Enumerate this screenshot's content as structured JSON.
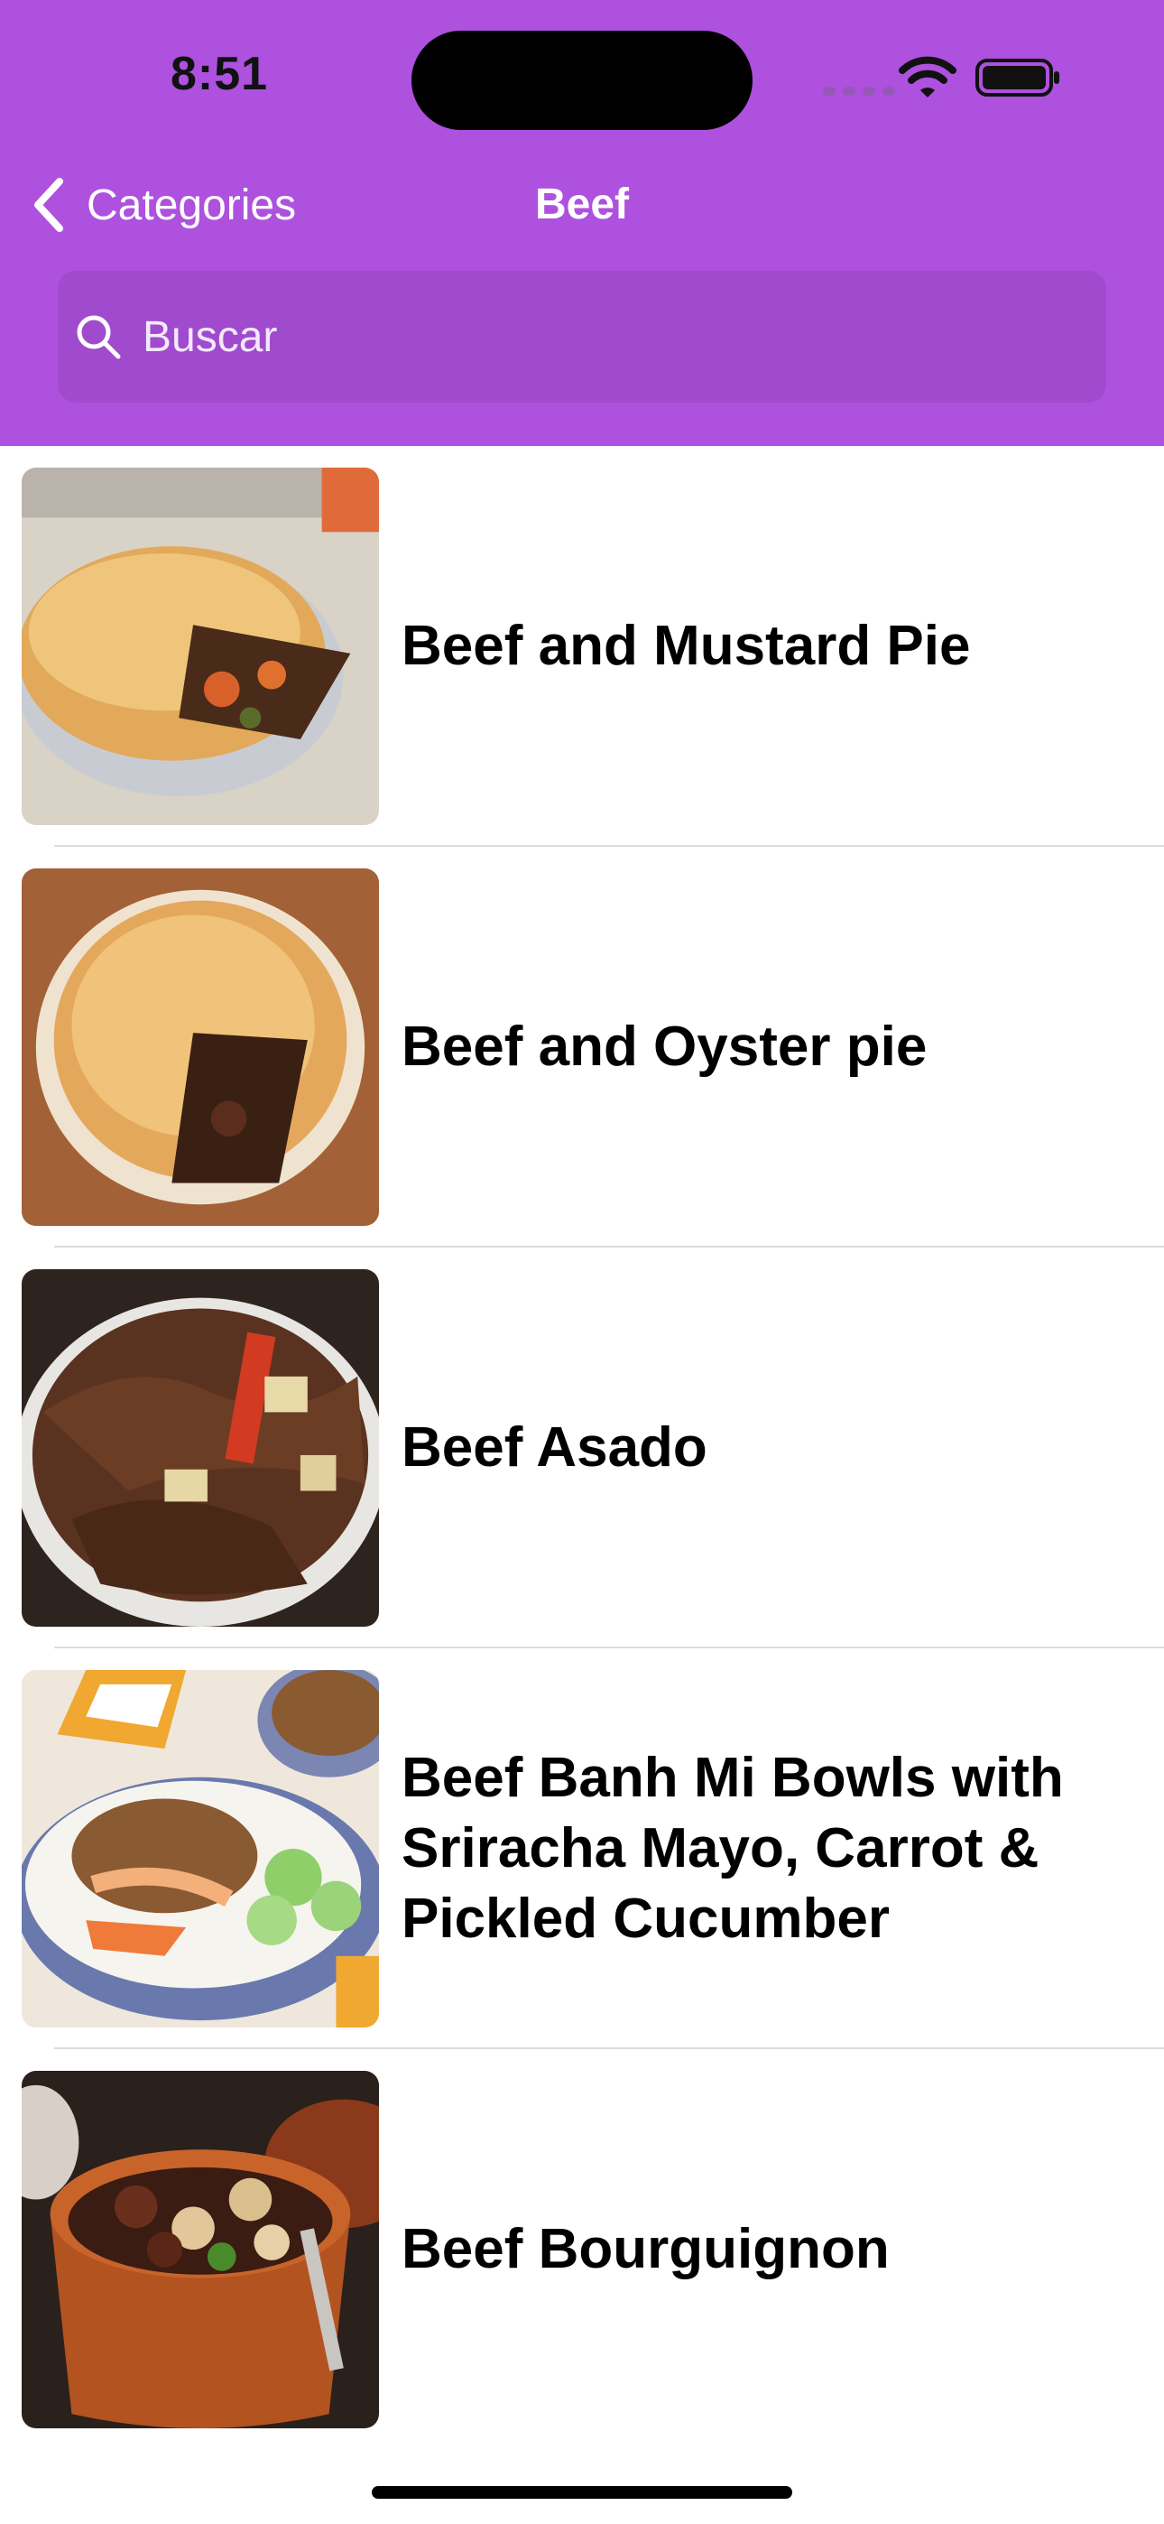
{
  "status_bar": {
    "time": "8:51"
  },
  "nav": {
    "back_label": "Categories",
    "title": "Beef"
  },
  "search": {
    "placeholder": "Buscar"
  },
  "meals": [
    {
      "name": "Beef and Mustard Pie"
    },
    {
      "name": "Beef and Oyster pie"
    },
    {
      "name": "Beef Asado"
    },
    {
      "name": "Beef Banh Mi Bowls with Sriracha Mayo, Carrot & Pickled Cucumber"
    },
    {
      "name": "Beef Bourguignon"
    }
  ],
  "colors": {
    "header_background": "#AD51DE",
    "header_text": "#FFFFFF",
    "row_text": "#000000"
  },
  "icons": {
    "back": "chevron-left-icon",
    "search": "search-icon",
    "wifi": "wifi-icon",
    "battery": "battery-icon"
  }
}
